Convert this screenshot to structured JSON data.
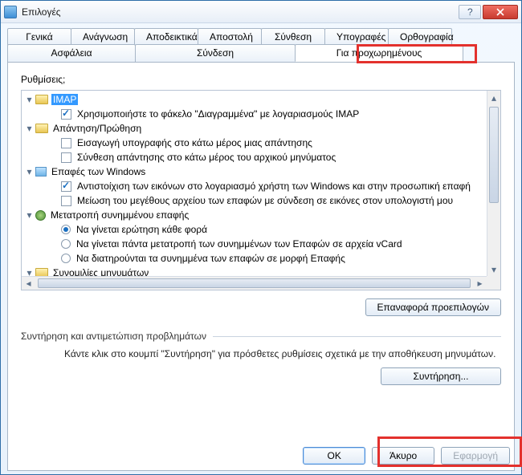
{
  "window": {
    "title": "Επιλογές"
  },
  "tabs_row1": [
    "Γενικά",
    "Ανάγνωση",
    "Αποδεικτικά",
    "Αποστολή",
    "Σύνθεση",
    "Υπογραφές",
    "Ορθογραφία"
  ],
  "tabs_row2": [
    "Ασφάλεια",
    "Σύνδεση",
    "Για προχωρημένους"
  ],
  "active_tab": "Για προχωρημένους",
  "settings_label": "Ρυθμίσεις;",
  "tree": [
    {
      "type": "folder",
      "expanded": true,
      "selected": true,
      "label": "IMAP"
    },
    {
      "type": "check",
      "checked": true,
      "indent": 2,
      "label": "Χρησιμοποιήστε το φάκελο \"Διαγραμμένα\" με λογαριασμούς IMAP"
    },
    {
      "type": "folder",
      "expanded": true,
      "label": "Απάντηση/Πρώθηση"
    },
    {
      "type": "check",
      "checked": false,
      "indent": 2,
      "label": "Εισαγωγή υπογραφής στο κάτω μέρος μιας απάντησης"
    },
    {
      "type": "check",
      "checked": false,
      "indent": 2,
      "label": "Σύνθεση απάντησης στο κάτω μέρος του αρχικού μηνύματος"
    },
    {
      "type": "folder",
      "expanded": true,
      "icon": "img",
      "label": "Επαφές των Windows"
    },
    {
      "type": "check",
      "checked": true,
      "indent": 2,
      "label": "Αντιστοίχιση των εικόνων στο λογαριασμό χρήστη των Windows και στην προσωπική επαφή"
    },
    {
      "type": "check",
      "checked": false,
      "indent": 2,
      "label": "Μείωση του μεγέθους αρχείου των επαφών με σύνδεση σε εικόνες στον υπολογιστή μου"
    },
    {
      "type": "folder",
      "expanded": true,
      "icon": "misc",
      "label": "Μετατροπή συνημμένου επαφής"
    },
    {
      "type": "radio",
      "checked": true,
      "indent": 2,
      "label": "Να γίνεται ερώτηση κάθε φορά"
    },
    {
      "type": "radio",
      "checked": false,
      "indent": 2,
      "label": "Να γίνεται πάντα μετατροπή των συνημμένων των Επαφών σε αρχεία vCard"
    },
    {
      "type": "radio",
      "checked": false,
      "indent": 2,
      "label": "Να διατηρούνται τα συνημμένα των επαφών σε μορφή Επαφής"
    },
    {
      "type": "folder",
      "expanded": true,
      "label": "Συνομιλίες μηνυμάτων"
    }
  ],
  "buttons": {
    "reset_defaults": "Επαναφορά προεπιλογών",
    "maintenance": "Συντήρηση...",
    "ok": "OK",
    "cancel": "Άκυρο",
    "apply": "Εφαρμογή"
  },
  "maintenance_group_label": "Συντήρηση και αντιμετώπιση προβλημάτων",
  "maintenance_desc": "Κάντε κλικ στο κουμπί \"Συντήρηση\" για πρόσθετες ρυθμίσεις σχετικά με την αποθήκευση μηνυμάτων."
}
